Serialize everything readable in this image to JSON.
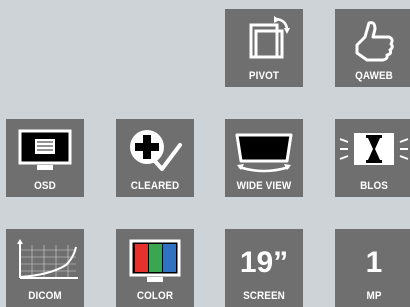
{
  "tiles": [
    {
      "name": "pivot",
      "label": "PIVOT",
      "icon": "pivot-rotate-icon"
    },
    {
      "name": "qaweb",
      "label": "QAWEB",
      "icon": "thumbs-up-icon"
    },
    {
      "name": "osd",
      "label": "OSD",
      "icon": "monitor-menu-icon"
    },
    {
      "name": "cleared",
      "label": "CLEARED",
      "icon": "medical-cross-check-icon"
    },
    {
      "name": "wide-view",
      "label": "WIDE VIEW",
      "icon": "wide-view-monitor-icon"
    },
    {
      "name": "blos",
      "label": "BLOS",
      "icon": "hourglass-monitor-icon"
    },
    {
      "name": "dicom",
      "label": "DICOM",
      "icon": "dicom-curve-icon"
    },
    {
      "name": "color",
      "label": "COLOR",
      "icon": "color-bars-monitor-icon"
    },
    {
      "name": "screen",
      "label": "SCREEN",
      "value": "19”"
    },
    {
      "name": "mp",
      "label": "MP",
      "value": "1"
    }
  ],
  "colors": {
    "background": "#ced3d7",
    "tile": "#6f6f6f",
    "red": "#e5302c",
    "green": "#3aa651",
    "blue": "#2f72c4"
  }
}
